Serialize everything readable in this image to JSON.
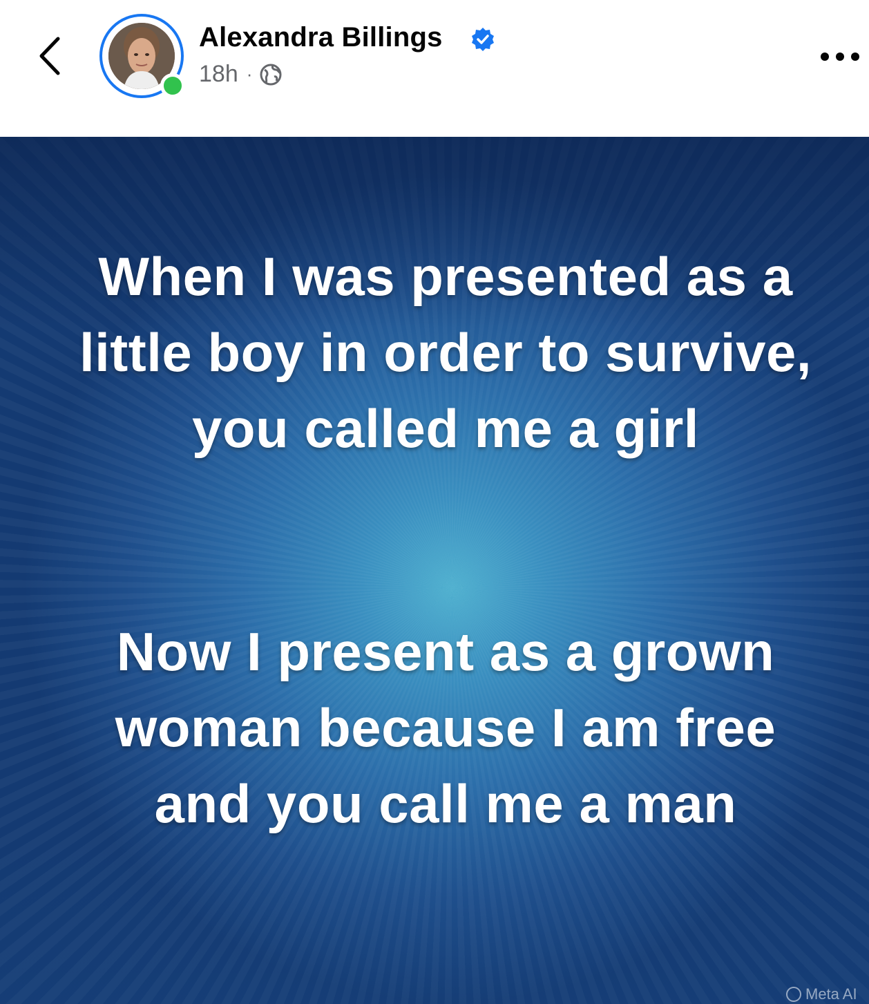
{
  "header": {
    "back_icon": "chevron-left-icon",
    "author_name": "Alexandra Billings",
    "verified_icon": "verified-badge-icon",
    "time_ago": "18h",
    "separator": "·",
    "privacy_icon": "globe-icon",
    "more_icon": "more-horizontal-icon",
    "online_status_color": "#31c24d",
    "ring_color": "#1877f2"
  },
  "post": {
    "paragraph_1": "When I was presented as a little boy in order to survive, you called me a girl",
    "paragraph_2": "Now I present as a grown woman because I am free and you call me a man",
    "watermark": "Meta AI"
  }
}
